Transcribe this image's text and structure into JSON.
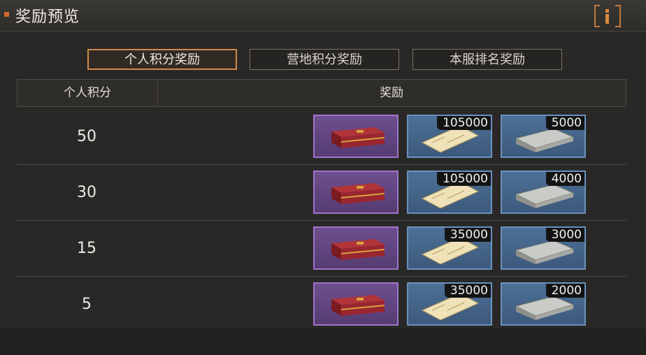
{
  "header": {
    "title": "奖励预览",
    "info_icon": "info-icon"
  },
  "tabs": [
    {
      "label": "个人积分奖励",
      "active": true
    },
    {
      "label": "营地积分奖励",
      "active": false
    },
    {
      "label": "本服排名奖励",
      "active": false
    }
  ],
  "table": {
    "col_score": "个人积分",
    "col_reward": "奖励",
    "rows": [
      {
        "score": "50",
        "rewards": [
          {
            "icon": "red-chest-icon"
          },
          {
            "icon": "paper-scroll-icon",
            "qty": "105000"
          },
          {
            "icon": "cash-stack-icon",
            "qty": "5000"
          }
        ]
      },
      {
        "score": "30",
        "rewards": [
          {
            "icon": "red-chest-icon"
          },
          {
            "icon": "paper-scroll-icon",
            "qty": "105000"
          },
          {
            "icon": "cash-stack-icon",
            "qty": "4000"
          }
        ]
      },
      {
        "score": "15",
        "rewards": [
          {
            "icon": "red-chest-icon"
          },
          {
            "icon": "paper-scroll-icon",
            "qty": "35000"
          },
          {
            "icon": "cash-stack-icon",
            "qty": "3000"
          }
        ]
      },
      {
        "score": "5",
        "rewards": [
          {
            "icon": "red-chest-icon"
          },
          {
            "icon": "paper-scroll-icon",
            "qty": "35000"
          },
          {
            "icon": "cash-stack-icon",
            "qty": "2000"
          }
        ]
      }
    ]
  },
  "colors": {
    "accent": "#d08a4a",
    "purple_rarity": "#9d76c9",
    "blue_rarity": "#6a92be"
  }
}
